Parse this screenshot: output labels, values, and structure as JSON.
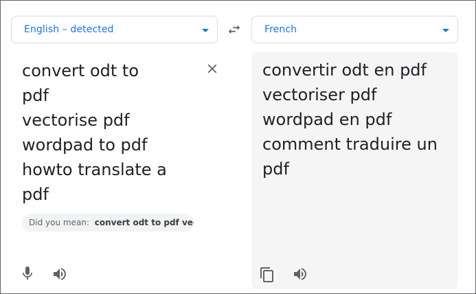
{
  "source": {
    "language": "English – detected",
    "text": "convert odt to\npdf\nvectorise pdf\nwordpad to pdf\nhowto translate a\npdf",
    "did_you_mean_label": "Did you mean:",
    "did_you_mean_suggestion": "convert odt to pdf vectoris..."
  },
  "target": {
    "language": "French",
    "text": "convertir odt en pdf\nvectoriser pdf\nwordpad en pdf\ncomment traduire un\npdf"
  },
  "icons": {
    "swap": "swap-arrows-icon",
    "clear": "close-icon",
    "dropdown": "caret-down-icon",
    "microphone": "microphone-icon",
    "speaker": "speaker-icon",
    "copy": "copy-icon"
  },
  "colors": {
    "accent": "#1a73e8",
    "text": "#202124",
    "muted": "#5f6368",
    "target_bg": "#f5f5f5"
  }
}
